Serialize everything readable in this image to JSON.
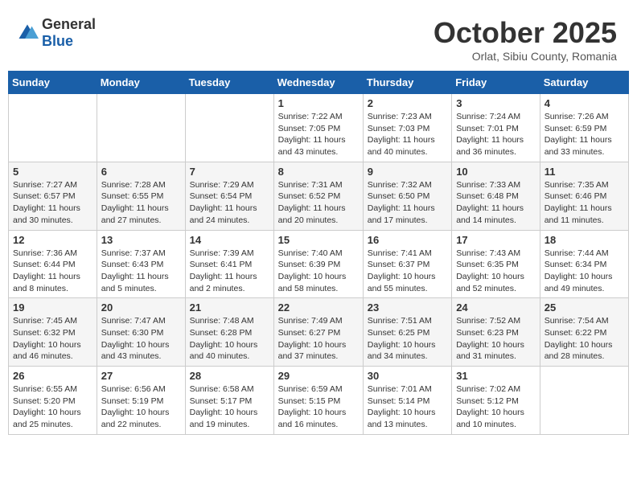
{
  "header": {
    "logo_general": "General",
    "logo_blue": "Blue",
    "month_title": "October 2025",
    "location": "Orlat, Sibiu County, Romania"
  },
  "days_of_week": [
    "Sunday",
    "Monday",
    "Tuesday",
    "Wednesday",
    "Thursday",
    "Friday",
    "Saturday"
  ],
  "weeks": [
    [
      {
        "day": "",
        "sunrise": "",
        "sunset": "",
        "daylight": ""
      },
      {
        "day": "",
        "sunrise": "",
        "sunset": "",
        "daylight": ""
      },
      {
        "day": "",
        "sunrise": "",
        "sunset": "",
        "daylight": ""
      },
      {
        "day": "1",
        "sunrise": "Sunrise: 7:22 AM",
        "sunset": "Sunset: 7:05 PM",
        "daylight": "Daylight: 11 hours and 43 minutes."
      },
      {
        "day": "2",
        "sunrise": "Sunrise: 7:23 AM",
        "sunset": "Sunset: 7:03 PM",
        "daylight": "Daylight: 11 hours and 40 minutes."
      },
      {
        "day": "3",
        "sunrise": "Sunrise: 7:24 AM",
        "sunset": "Sunset: 7:01 PM",
        "daylight": "Daylight: 11 hours and 36 minutes."
      },
      {
        "day": "4",
        "sunrise": "Sunrise: 7:26 AM",
        "sunset": "Sunset: 6:59 PM",
        "daylight": "Daylight: 11 hours and 33 minutes."
      }
    ],
    [
      {
        "day": "5",
        "sunrise": "Sunrise: 7:27 AM",
        "sunset": "Sunset: 6:57 PM",
        "daylight": "Daylight: 11 hours and 30 minutes."
      },
      {
        "day": "6",
        "sunrise": "Sunrise: 7:28 AM",
        "sunset": "Sunset: 6:55 PM",
        "daylight": "Daylight: 11 hours and 27 minutes."
      },
      {
        "day": "7",
        "sunrise": "Sunrise: 7:29 AM",
        "sunset": "Sunset: 6:54 PM",
        "daylight": "Daylight: 11 hours and 24 minutes."
      },
      {
        "day": "8",
        "sunrise": "Sunrise: 7:31 AM",
        "sunset": "Sunset: 6:52 PM",
        "daylight": "Daylight: 11 hours and 20 minutes."
      },
      {
        "day": "9",
        "sunrise": "Sunrise: 7:32 AM",
        "sunset": "Sunset: 6:50 PM",
        "daylight": "Daylight: 11 hours and 17 minutes."
      },
      {
        "day": "10",
        "sunrise": "Sunrise: 7:33 AM",
        "sunset": "Sunset: 6:48 PM",
        "daylight": "Daylight: 11 hours and 14 minutes."
      },
      {
        "day": "11",
        "sunrise": "Sunrise: 7:35 AM",
        "sunset": "Sunset: 6:46 PM",
        "daylight": "Daylight: 11 hours and 11 minutes."
      }
    ],
    [
      {
        "day": "12",
        "sunrise": "Sunrise: 7:36 AM",
        "sunset": "Sunset: 6:44 PM",
        "daylight": "Daylight: 11 hours and 8 minutes."
      },
      {
        "day": "13",
        "sunrise": "Sunrise: 7:37 AM",
        "sunset": "Sunset: 6:43 PM",
        "daylight": "Daylight: 11 hours and 5 minutes."
      },
      {
        "day": "14",
        "sunrise": "Sunrise: 7:39 AM",
        "sunset": "Sunset: 6:41 PM",
        "daylight": "Daylight: 11 hours and 2 minutes."
      },
      {
        "day": "15",
        "sunrise": "Sunrise: 7:40 AM",
        "sunset": "Sunset: 6:39 PM",
        "daylight": "Daylight: 10 hours and 58 minutes."
      },
      {
        "day": "16",
        "sunrise": "Sunrise: 7:41 AM",
        "sunset": "Sunset: 6:37 PM",
        "daylight": "Daylight: 10 hours and 55 minutes."
      },
      {
        "day": "17",
        "sunrise": "Sunrise: 7:43 AM",
        "sunset": "Sunset: 6:35 PM",
        "daylight": "Daylight: 10 hours and 52 minutes."
      },
      {
        "day": "18",
        "sunrise": "Sunrise: 7:44 AM",
        "sunset": "Sunset: 6:34 PM",
        "daylight": "Daylight: 10 hours and 49 minutes."
      }
    ],
    [
      {
        "day": "19",
        "sunrise": "Sunrise: 7:45 AM",
        "sunset": "Sunset: 6:32 PM",
        "daylight": "Daylight: 10 hours and 46 minutes."
      },
      {
        "day": "20",
        "sunrise": "Sunrise: 7:47 AM",
        "sunset": "Sunset: 6:30 PM",
        "daylight": "Daylight: 10 hours and 43 minutes."
      },
      {
        "day": "21",
        "sunrise": "Sunrise: 7:48 AM",
        "sunset": "Sunset: 6:28 PM",
        "daylight": "Daylight: 10 hours and 40 minutes."
      },
      {
        "day": "22",
        "sunrise": "Sunrise: 7:49 AM",
        "sunset": "Sunset: 6:27 PM",
        "daylight": "Daylight: 10 hours and 37 minutes."
      },
      {
        "day": "23",
        "sunrise": "Sunrise: 7:51 AM",
        "sunset": "Sunset: 6:25 PM",
        "daylight": "Daylight: 10 hours and 34 minutes."
      },
      {
        "day": "24",
        "sunrise": "Sunrise: 7:52 AM",
        "sunset": "Sunset: 6:23 PM",
        "daylight": "Daylight: 10 hours and 31 minutes."
      },
      {
        "day": "25",
        "sunrise": "Sunrise: 7:54 AM",
        "sunset": "Sunset: 6:22 PM",
        "daylight": "Daylight: 10 hours and 28 minutes."
      }
    ],
    [
      {
        "day": "26",
        "sunrise": "Sunrise: 6:55 AM",
        "sunset": "Sunset: 5:20 PM",
        "daylight": "Daylight: 10 hours and 25 minutes."
      },
      {
        "day": "27",
        "sunrise": "Sunrise: 6:56 AM",
        "sunset": "Sunset: 5:19 PM",
        "daylight": "Daylight: 10 hours and 22 minutes."
      },
      {
        "day": "28",
        "sunrise": "Sunrise: 6:58 AM",
        "sunset": "Sunset: 5:17 PM",
        "daylight": "Daylight: 10 hours and 19 minutes."
      },
      {
        "day": "29",
        "sunrise": "Sunrise: 6:59 AM",
        "sunset": "Sunset: 5:15 PM",
        "daylight": "Daylight: 10 hours and 16 minutes."
      },
      {
        "day": "30",
        "sunrise": "Sunrise: 7:01 AM",
        "sunset": "Sunset: 5:14 PM",
        "daylight": "Daylight: 10 hours and 13 minutes."
      },
      {
        "day": "31",
        "sunrise": "Sunrise: 7:02 AM",
        "sunset": "Sunset: 5:12 PM",
        "daylight": "Daylight: 10 hours and 10 minutes."
      },
      {
        "day": "",
        "sunrise": "",
        "sunset": "",
        "daylight": ""
      }
    ]
  ]
}
